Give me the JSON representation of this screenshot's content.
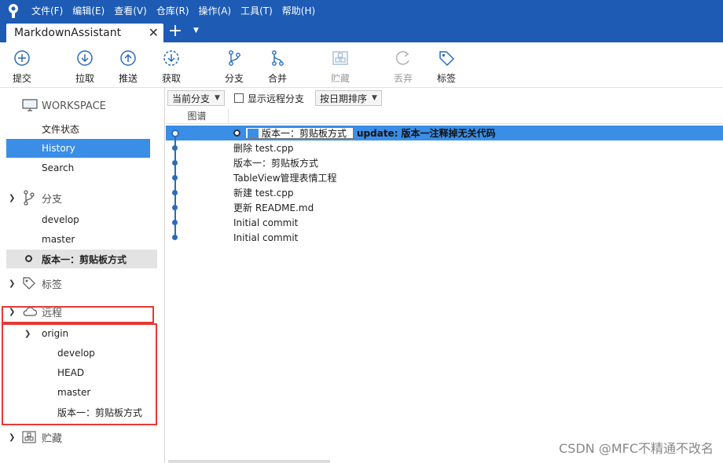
{
  "menu": [
    "文件(F)",
    "编辑(E)",
    "查看(V)",
    "仓库(R)",
    "操作(A)",
    "工具(T)",
    "帮助(H)"
  ],
  "tab": {
    "title": "MarkdownAssistant",
    "close": "✕",
    "add": "+",
    "menu": "▼"
  },
  "toolbar": {
    "commit": "提交",
    "pull": "拉取",
    "push": "推送",
    "fetch": "获取",
    "branch": "分支",
    "merge": "合并",
    "stash": "贮藏",
    "discard": "丢弃",
    "tag": "标签"
  },
  "sidebar": {
    "workspace": "WORKSPACE",
    "file_status": "文件状态",
    "history": "History",
    "search": "Search",
    "branches": "分支",
    "branch_items": [
      "develop",
      "master",
      "版本一：剪贴板方式"
    ],
    "tags": "标签",
    "remotes": "远程",
    "origin": "origin",
    "remote_items": [
      "develop",
      "HEAD",
      "master",
      "版本一：剪贴板方式"
    ],
    "stashes": "贮藏"
  },
  "filters": {
    "current_branch": "当前分支",
    "show_remote": "显示远程分支",
    "sort": "按日期排序"
  },
  "columns": {
    "graph": "图谱"
  },
  "commits": [
    {
      "tag": "版本一：剪贴板方式",
      "message": "update: 版本一注释掉无关代码"
    },
    {
      "message": "删除 test.cpp"
    },
    {
      "message": "版本一：剪贴板方式"
    },
    {
      "message": "TableView管理表情工程"
    },
    {
      "message": "新建 test.cpp"
    },
    {
      "message": "更新 README.md"
    },
    {
      "message": "Initial commit"
    },
    {
      "message": "Initial commit"
    }
  ],
  "watermark": "CSDN @MFC不精通不改名"
}
